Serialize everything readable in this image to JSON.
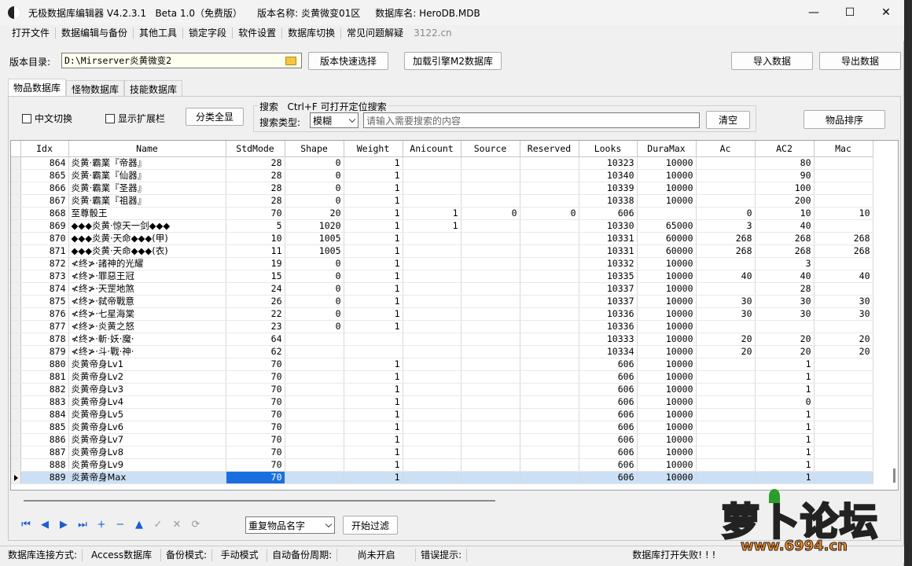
{
  "window": {
    "title": "无极数据库编辑器 V4.2.3.1   Beta 1.0（免费版）     版本名称: 炎黄微变01区     数据库名: HeroDB.MDB",
    "controls": {
      "minimize": "—",
      "maximize": "☐",
      "close": "✕"
    }
  },
  "menu": {
    "items": [
      "打开文件",
      "数据编辑与备份",
      "其他工具",
      "锁定字段",
      "软件设置",
      "数据库切换",
      "常见问题解疑"
    ],
    "url": "3122.cn"
  },
  "toolbar": {
    "version_dir_label": "版本目录:",
    "version_dir_value": "D:\\Mirserver炎黄微变2",
    "quick_select": "版本快速选择",
    "load_engine": "加载引擎M2数据库",
    "import": "导入数据",
    "export": "导出数据"
  },
  "tabs": [
    "物品数据库",
    "怪物数据库",
    "技能数据库"
  ],
  "filters": {
    "chinese_toggle": "中文切换",
    "show_ext": "显示扩展栏",
    "show_all": "分类全显",
    "search_title": "搜索   Ctrl+F 可打开定位搜索",
    "search_type_label": "搜索类型:",
    "search_type_value": "模糊",
    "search_placeholder": "请输入需要搜索的内容",
    "clear": "清空",
    "sort": "物品排序"
  },
  "table": {
    "columns": [
      "Idx",
      "Name",
      "StdMode",
      "Shape",
      "Weight",
      "Anicount",
      "Source",
      "Reserved",
      "Looks",
      "DuraMax",
      "Ac",
      "AC2",
      "Mac"
    ],
    "rows": [
      [
        "864",
        "炎黄·霸業『帝器』",
        "28",
        "0",
        "1",
        "",
        "",
        "",
        "10323",
        "10000",
        "",
        "80",
        ""
      ],
      [
        "865",
        "炎黄·霸業『仙器』",
        "28",
        "0",
        "1",
        "",
        "",
        "",
        "10340",
        "10000",
        "",
        "90",
        ""
      ],
      [
        "866",
        "炎黄·霸業『圣器』",
        "28",
        "0",
        "1",
        "",
        "",
        "",
        "10339",
        "10000",
        "",
        "100",
        ""
      ],
      [
        "867",
        "炎黄·霸業『祖器』",
        "28",
        "0",
        "1",
        "",
        "",
        "",
        "10338",
        "10000",
        "",
        "200",
        ""
      ],
      [
        "868",
        "至尊骰王",
        "70",
        "20",
        "1",
        "1",
        "0",
        "0",
        "606",
        "",
        "0",
        "10",
        "10"
      ],
      [
        "869",
        "◆◆◆炎黄·惊天一剑◆◆◆",
        "5",
        "1020",
        "1",
        "1",
        "",
        "",
        "10330",
        "65000",
        "3",
        "40",
        ""
      ],
      [
        "870",
        "◆◆◆炎黄·天命◆◆◆(甲)",
        "10",
        "1005",
        "1",
        "",
        "",
        "",
        "10331",
        "60000",
        "268",
        "268",
        "268"
      ],
      [
        "871",
        "◆◆◆炎黄·天命◆◆◆(衣)",
        "11",
        "1005",
        "1",
        "",
        "",
        "",
        "10331",
        "60000",
        "268",
        "268",
        "268"
      ],
      [
        "872",
        "≮终≯·諸神的光耀",
        "19",
        "0",
        "1",
        "",
        "",
        "",
        "10332",
        "10000",
        "",
        "3",
        ""
      ],
      [
        "873",
        "≮终≯·罪惡王冠",
        "15",
        "0",
        "1",
        "",
        "",
        "",
        "10335",
        "10000",
        "40",
        "40",
        "40"
      ],
      [
        "874",
        "≮终≯·天罡地煞",
        "24",
        "0",
        "1",
        "",
        "",
        "",
        "10337",
        "10000",
        "",
        "28",
        ""
      ],
      [
        "875",
        "≮终≯·弑帝戰意",
        "26",
        "0",
        "1",
        "",
        "",
        "",
        "10337",
        "10000",
        "30",
        "30",
        "30"
      ],
      [
        "876",
        "≮终≯·七星海棠",
        "22",
        "0",
        "1",
        "",
        "",
        "",
        "10336",
        "10000",
        "30",
        "30",
        "30"
      ],
      [
        "877",
        "≮终≯·炎黄之怒",
        "23",
        "0",
        "1",
        "",
        "",
        "",
        "10336",
        "10000",
        "",
        "",
        ""
      ],
      [
        "878",
        "≮终≯·斬·妖·魔·",
        "64",
        "",
        "",
        "",
        "",
        "",
        "10333",
        "10000",
        "20",
        "20",
        "20"
      ],
      [
        "879",
        "≮终≯·斗·戰·神·",
        "62",
        "",
        "",
        "",
        "",
        "",
        "10334",
        "10000",
        "20",
        "20",
        "20"
      ],
      [
        "880",
        "炎黄帝身Lv1",
        "70",
        "",
        "1",
        "",
        "",
        "",
        "606",
        "10000",
        "",
        "1",
        ""
      ],
      [
        "881",
        "炎黄帝身Lv2",
        "70",
        "",
        "1",
        "",
        "",
        "",
        "606",
        "10000",
        "",
        "1",
        ""
      ],
      [
        "882",
        "炎黄帝身Lv3",
        "70",
        "",
        "1",
        "",
        "",
        "",
        "606",
        "10000",
        "",
        "1",
        ""
      ],
      [
        "883",
        "炎黄帝身Lv4",
        "70",
        "",
        "1",
        "",
        "",
        "",
        "606",
        "10000",
        "",
        "0",
        ""
      ],
      [
        "884",
        "炎黄帝身Lv5",
        "70",
        "",
        "1",
        "",
        "",
        "",
        "606",
        "10000",
        "",
        "1",
        ""
      ],
      [
        "885",
        "炎黄帝身Lv6",
        "70",
        "",
        "1",
        "",
        "",
        "",
        "606",
        "10000",
        "",
        "1",
        ""
      ],
      [
        "886",
        "炎黄帝身Lv7",
        "70",
        "",
        "1",
        "",
        "",
        "",
        "606",
        "10000",
        "",
        "1",
        ""
      ],
      [
        "887",
        "炎黄帝身Lv8",
        "70",
        "",
        "1",
        "",
        "",
        "",
        "606",
        "10000",
        "",
        "1",
        ""
      ],
      [
        "888",
        "炎黄帝身Lv9",
        "70",
        "",
        "1",
        "",
        "",
        "",
        "606",
        "10000",
        "",
        "1",
        ""
      ],
      [
        "889",
        "炎黄帝身Max",
        "70",
        "",
        "1",
        "",
        "",
        "",
        "606",
        "10000",
        "",
        "1",
        ""
      ]
    ],
    "selected_row": 25
  },
  "navigator": {
    "icons": [
      "first-icon",
      "prior-icon",
      "next-icon",
      "last-icon",
      "insert-icon",
      "delete-icon",
      "edit-icon",
      "post-icon",
      "cancel-icon",
      "refresh-icon"
    ],
    "glyphs": [
      "⏮",
      "◀",
      "▶",
      "⏭",
      "+",
      "−",
      "▲",
      "✓",
      "✕",
      "⟳"
    ],
    "duplicate_select": "重复物品名字",
    "start_filter": "开始过滤"
  },
  "status": {
    "conn_label": "数据库连接方式:",
    "conn_value": "Access数据库",
    "backup_label": "备份模式:",
    "backup_value": "手动模式",
    "auto_label": "自动备份周期:",
    "auto_value": "尚未开启",
    "error_label": "错误提示:",
    "error_value": "数据库打开失败! ! !"
  },
  "watermark": {
    "text": "萝卜论坛",
    "url": "www.6994.cn"
  }
}
